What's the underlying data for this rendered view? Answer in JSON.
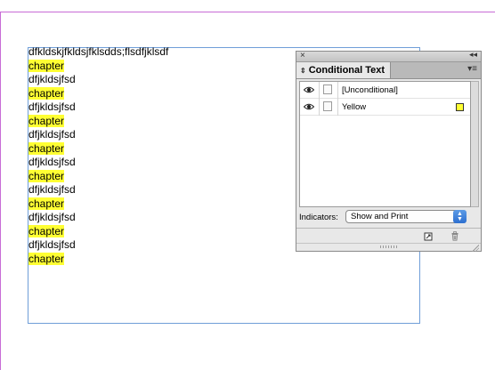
{
  "document": {
    "lines": [
      {
        "text": "dfkldskjfkldsjfklsdds;flsdfjklsdf",
        "highlight": false
      },
      {
        "text": "chapter",
        "highlight": true
      },
      {
        "text": "dfjkldsjfsd",
        "highlight": false
      },
      {
        "text": "chapter",
        "highlight": true
      },
      {
        "text": "dfjkldsjfsd",
        "highlight": false
      },
      {
        "text": "chapter",
        "highlight": true
      },
      {
        "text": "dfjkldsjfsd",
        "highlight": false
      },
      {
        "text": "chapter",
        "highlight": true
      },
      {
        "text": "dfjkldsjfsd",
        "highlight": false
      },
      {
        "text": "chapter",
        "highlight": true
      },
      {
        "text": "dfjkldsjfsd",
        "highlight": false
      },
      {
        "text": "chapter",
        "highlight": true
      },
      {
        "text": "dfjkldsjfsd",
        "highlight": false
      },
      {
        "text": "chapter",
        "highlight": true
      },
      {
        "text": "dfjkldsjfsd",
        "highlight": false
      },
      {
        "text": "chapter",
        "highlight": true
      }
    ],
    "highlight_color": "#ffff33",
    "page_border_color": "#c86cd6",
    "frame_border_color": "#6f9ed8"
  },
  "panel": {
    "topbar": {
      "close_icon": "×",
      "collapse_icon": "◂◂"
    },
    "tab_label": "Conditional Text",
    "tab_icon": "⇕",
    "menu_icon": "▾≡",
    "conditions": [
      {
        "label": "[Unconditional]",
        "visible": true,
        "swatch": null
      },
      {
        "label": "Yellow",
        "visible": true,
        "swatch": "#ffff33"
      }
    ],
    "indicators": {
      "label": "Indicators:",
      "value": "Show and Print"
    }
  }
}
